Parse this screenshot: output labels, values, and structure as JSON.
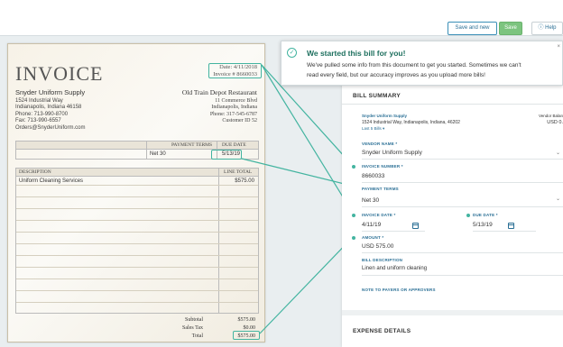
{
  "toolbar": {
    "save_and_new": "Save and new",
    "save": "Save",
    "help": "Help"
  },
  "invoice_doc": {
    "title": "INVOICE",
    "date_label": "Date:",
    "date_value": "4/11/2018",
    "invoice_label": "Invoice #",
    "invoice_value": "8660033",
    "vendor": {
      "name": "Snyder Uniform Supply",
      "line1": "1524 Industrial Way",
      "line2": "Indianapolis, Indiana 46158",
      "phone": "Phone: 713-990-8700",
      "fax": "Fax: 713-990-6557",
      "email": "Orders@SnyderUniform.com"
    },
    "customer": {
      "name": "Old Train Depot Restaurant",
      "line1": "11 Commerce Blvd",
      "line2": "Indianapolis, Indiana",
      "phone": "Phone: 317-545-6787",
      "id": "Customer ID 52"
    },
    "terms_header": "PAYMENT TERMS",
    "due_header": "DUE DATE",
    "terms_value": "Net 30",
    "due_value": "5/13/19",
    "desc_header": "DESCRIPTION",
    "total_header": "LINE TOTAL",
    "line_desc": "Uniform Cleaning Services",
    "line_total": "$575.00",
    "subtotal_label": "Subtotal",
    "subtotal_value": "$575.00",
    "tax_label": "Sales Tax",
    "tax_value": "$0.00",
    "total_label": "Total",
    "total_value": "$575.00"
  },
  "toast": {
    "title": "We started this bill for you!",
    "message_line1": "We've pulled some info from this document to get you started. Sometimes we can't",
    "message_line2": "read every field, but our accuracy improves as you upload more bills!"
  },
  "bill": {
    "header": "BILL SUMMARY",
    "vendor_title": "Snyder Uniform Supply",
    "vendor_address": "1524 Industrial Way, Indianapolis, Indiana, 46202",
    "last_bills": "Last 5 Bills ▾",
    "vendor_balance_label": "Vendor Balan",
    "vendor_balance_value": "USD 0.",
    "vendor_name_label": "VENDOR NAME *",
    "vendor_name_value": "Snyder Uniform Supply",
    "invoice_number_label": "INVOICE NUMBER *",
    "invoice_number_value": "8660033",
    "payment_terms_label": "PAYMENT TERMS",
    "payment_terms_value": "Net 30",
    "invoice_date_label": "INVOICE DATE *",
    "invoice_date_value": "4/11/19",
    "due_date_label": "DUE DATE *",
    "due_date_value": "5/13/19",
    "amount_label": "AMOUNT *",
    "amount_value": "USD 575.00",
    "description_label": "BILL DESCRIPTION",
    "description_value": "Linen and uniform cleaning",
    "note_label": "NOTE TO PAYERS OR APPROVERS",
    "expense_header": "EXPENSE DETAILS"
  },
  "colors": {
    "accent": "#2a6f95",
    "highlight": "#43b4a0",
    "save_green": "#7cc47f"
  }
}
